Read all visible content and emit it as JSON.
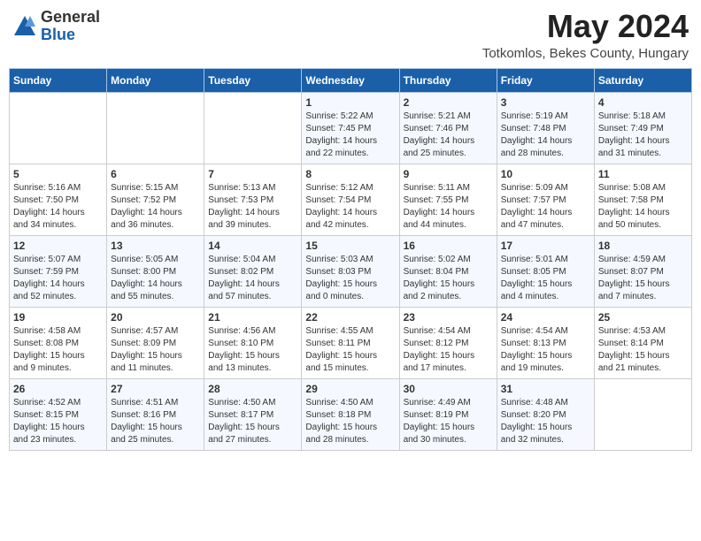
{
  "header": {
    "logo_general": "General",
    "logo_blue": "Blue",
    "title": "May 2024",
    "location": "Totkomlos, Bekes County, Hungary"
  },
  "weekdays": [
    "Sunday",
    "Monday",
    "Tuesday",
    "Wednesday",
    "Thursday",
    "Friday",
    "Saturday"
  ],
  "weeks": [
    [
      {
        "day": "",
        "info": ""
      },
      {
        "day": "",
        "info": ""
      },
      {
        "day": "",
        "info": ""
      },
      {
        "day": "1",
        "info": "Sunrise: 5:22 AM\nSunset: 7:45 PM\nDaylight: 14 hours\nand 22 minutes."
      },
      {
        "day": "2",
        "info": "Sunrise: 5:21 AM\nSunset: 7:46 PM\nDaylight: 14 hours\nand 25 minutes."
      },
      {
        "day": "3",
        "info": "Sunrise: 5:19 AM\nSunset: 7:48 PM\nDaylight: 14 hours\nand 28 minutes."
      },
      {
        "day": "4",
        "info": "Sunrise: 5:18 AM\nSunset: 7:49 PM\nDaylight: 14 hours\nand 31 minutes."
      }
    ],
    [
      {
        "day": "5",
        "info": "Sunrise: 5:16 AM\nSunset: 7:50 PM\nDaylight: 14 hours\nand 34 minutes."
      },
      {
        "day": "6",
        "info": "Sunrise: 5:15 AM\nSunset: 7:52 PM\nDaylight: 14 hours\nand 36 minutes."
      },
      {
        "day": "7",
        "info": "Sunrise: 5:13 AM\nSunset: 7:53 PM\nDaylight: 14 hours\nand 39 minutes."
      },
      {
        "day": "8",
        "info": "Sunrise: 5:12 AM\nSunset: 7:54 PM\nDaylight: 14 hours\nand 42 minutes."
      },
      {
        "day": "9",
        "info": "Sunrise: 5:11 AM\nSunset: 7:55 PM\nDaylight: 14 hours\nand 44 minutes."
      },
      {
        "day": "10",
        "info": "Sunrise: 5:09 AM\nSunset: 7:57 PM\nDaylight: 14 hours\nand 47 minutes."
      },
      {
        "day": "11",
        "info": "Sunrise: 5:08 AM\nSunset: 7:58 PM\nDaylight: 14 hours\nand 50 minutes."
      }
    ],
    [
      {
        "day": "12",
        "info": "Sunrise: 5:07 AM\nSunset: 7:59 PM\nDaylight: 14 hours\nand 52 minutes."
      },
      {
        "day": "13",
        "info": "Sunrise: 5:05 AM\nSunset: 8:00 PM\nDaylight: 14 hours\nand 55 minutes."
      },
      {
        "day": "14",
        "info": "Sunrise: 5:04 AM\nSunset: 8:02 PM\nDaylight: 14 hours\nand 57 minutes."
      },
      {
        "day": "15",
        "info": "Sunrise: 5:03 AM\nSunset: 8:03 PM\nDaylight: 15 hours\nand 0 minutes."
      },
      {
        "day": "16",
        "info": "Sunrise: 5:02 AM\nSunset: 8:04 PM\nDaylight: 15 hours\nand 2 minutes."
      },
      {
        "day": "17",
        "info": "Sunrise: 5:01 AM\nSunset: 8:05 PM\nDaylight: 15 hours\nand 4 minutes."
      },
      {
        "day": "18",
        "info": "Sunrise: 4:59 AM\nSunset: 8:07 PM\nDaylight: 15 hours\nand 7 minutes."
      }
    ],
    [
      {
        "day": "19",
        "info": "Sunrise: 4:58 AM\nSunset: 8:08 PM\nDaylight: 15 hours\nand 9 minutes."
      },
      {
        "day": "20",
        "info": "Sunrise: 4:57 AM\nSunset: 8:09 PM\nDaylight: 15 hours\nand 11 minutes."
      },
      {
        "day": "21",
        "info": "Sunrise: 4:56 AM\nSunset: 8:10 PM\nDaylight: 15 hours\nand 13 minutes."
      },
      {
        "day": "22",
        "info": "Sunrise: 4:55 AM\nSunset: 8:11 PM\nDaylight: 15 hours\nand 15 minutes."
      },
      {
        "day": "23",
        "info": "Sunrise: 4:54 AM\nSunset: 8:12 PM\nDaylight: 15 hours\nand 17 minutes."
      },
      {
        "day": "24",
        "info": "Sunrise: 4:54 AM\nSunset: 8:13 PM\nDaylight: 15 hours\nand 19 minutes."
      },
      {
        "day": "25",
        "info": "Sunrise: 4:53 AM\nSunset: 8:14 PM\nDaylight: 15 hours\nand 21 minutes."
      }
    ],
    [
      {
        "day": "26",
        "info": "Sunrise: 4:52 AM\nSunset: 8:15 PM\nDaylight: 15 hours\nand 23 minutes."
      },
      {
        "day": "27",
        "info": "Sunrise: 4:51 AM\nSunset: 8:16 PM\nDaylight: 15 hours\nand 25 minutes."
      },
      {
        "day": "28",
        "info": "Sunrise: 4:50 AM\nSunset: 8:17 PM\nDaylight: 15 hours\nand 27 minutes."
      },
      {
        "day": "29",
        "info": "Sunrise: 4:50 AM\nSunset: 8:18 PM\nDaylight: 15 hours\nand 28 minutes."
      },
      {
        "day": "30",
        "info": "Sunrise: 4:49 AM\nSunset: 8:19 PM\nDaylight: 15 hours\nand 30 minutes."
      },
      {
        "day": "31",
        "info": "Sunrise: 4:48 AM\nSunset: 8:20 PM\nDaylight: 15 hours\nand 32 minutes."
      },
      {
        "day": "",
        "info": ""
      }
    ]
  ]
}
